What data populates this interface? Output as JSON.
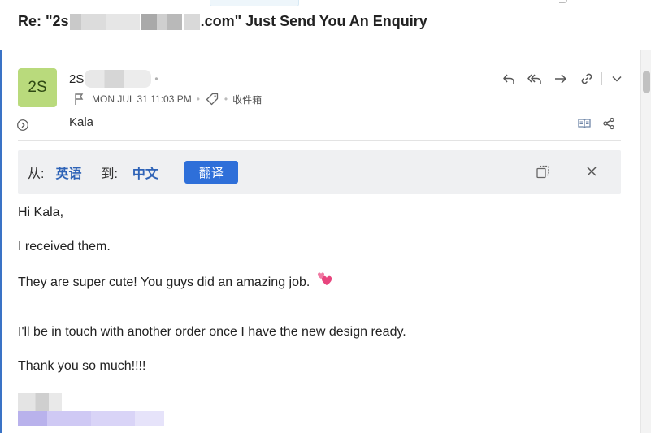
{
  "subject": {
    "prefix": "Re: \"2s",
    "suffix": ".com\" Just Send You An Enquiry"
  },
  "sender": {
    "avatar_initials": "2S",
    "avatar_color": "#b9da7c",
    "name_visible": "2S"
  },
  "meta": {
    "date": "MON JUL 31 11:03 PM",
    "folder": "收件箱"
  },
  "recipient": "Kala",
  "toolbar": {
    "icons": [
      "reply-icon",
      "reply-all-icon",
      "forward-icon",
      "link-icon",
      "chevron-down-icon"
    ],
    "secondary_icons": [
      "reader-view-icon",
      "share-icon"
    ]
  },
  "translate_bar": {
    "from_label": "从:",
    "from_lang": "英语",
    "to_label": "到:",
    "to_lang": "中文",
    "button_label": "翻译"
  },
  "body": {
    "line1": "Hi Kala,",
    "line2": "I received them.",
    "line3": "They are super cute! You guys did an amazing job.",
    "line4": "I'll be in touch with another order once I have the new design ready.",
    "line5": "Thank you so much!!!!"
  },
  "colors": {
    "accent": "#2e6fd9",
    "lang_text": "#2e63b7",
    "left_accent": "#3a73c6"
  }
}
